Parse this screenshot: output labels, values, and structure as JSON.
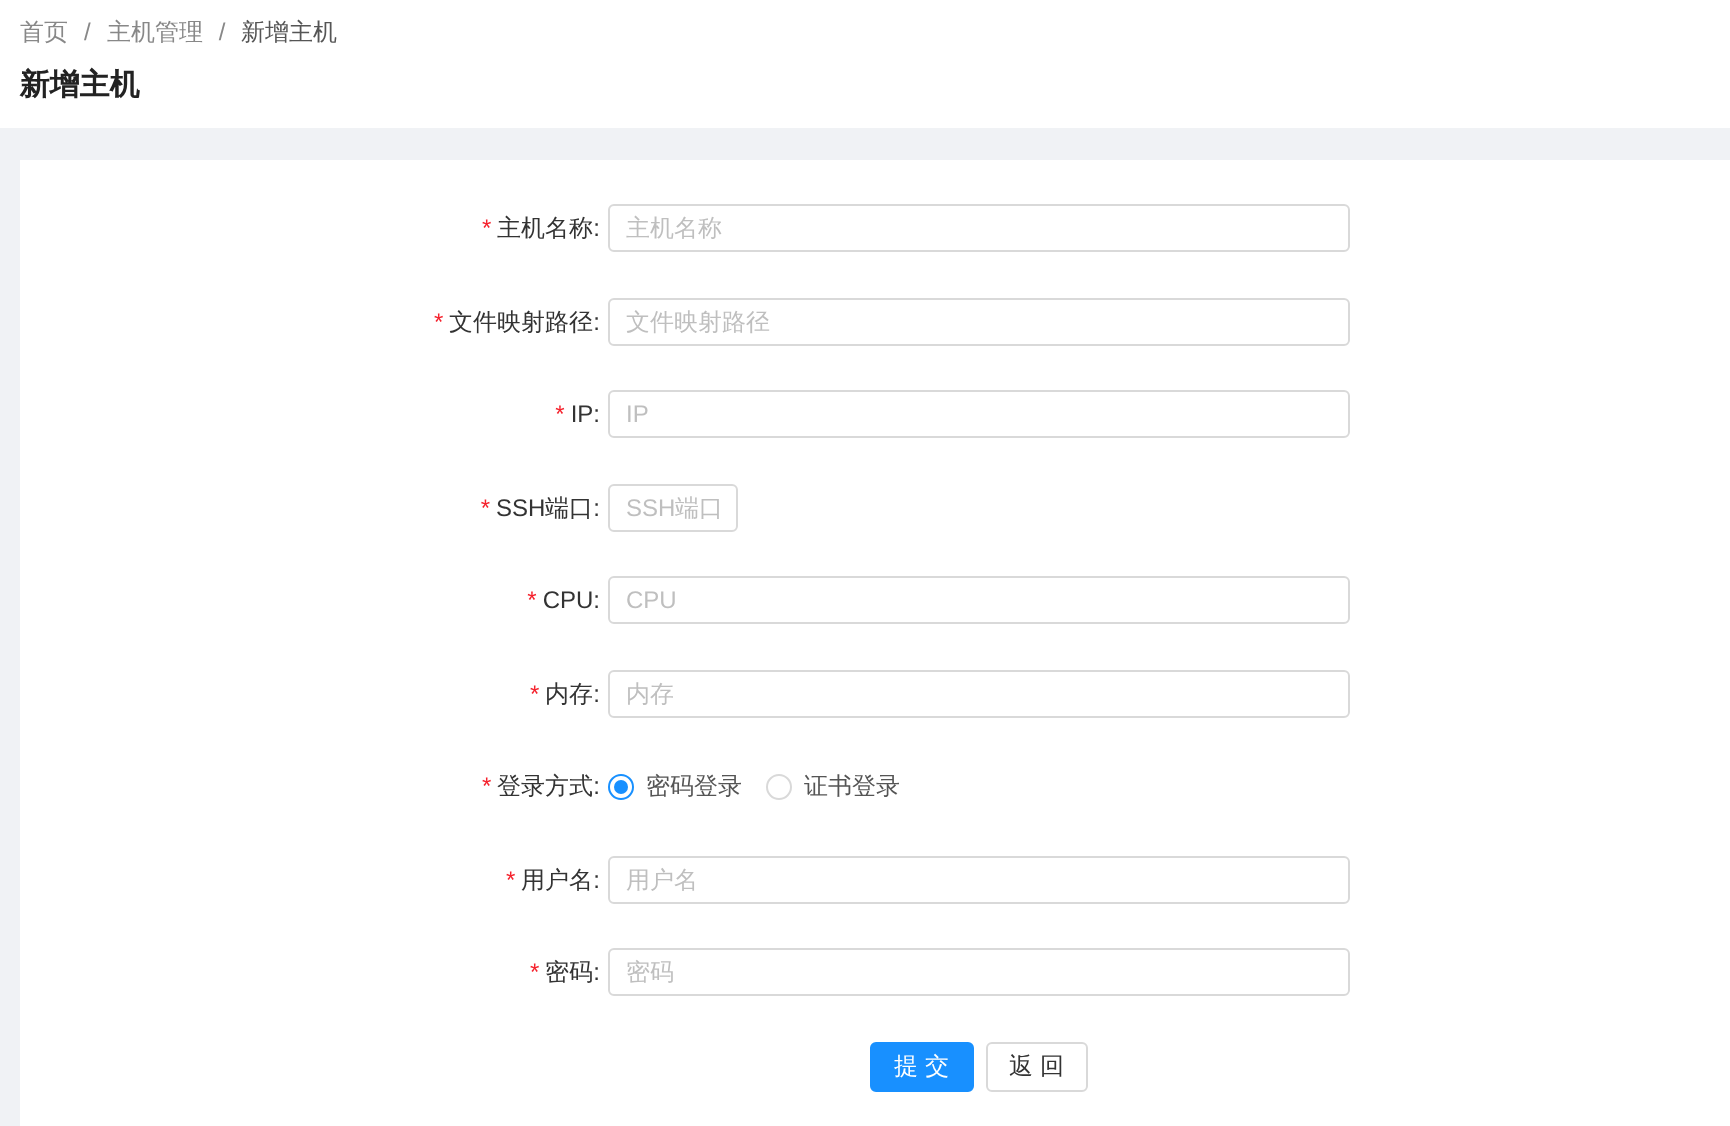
{
  "breadcrumb": [
    {
      "label": "首页",
      "current": false
    },
    {
      "label": "主机管理",
      "current": false
    },
    {
      "label": "新增主机",
      "current": true
    }
  ],
  "breadcrumb_separator": "/",
  "title": "新增主机",
  "fields": [
    {
      "kind": "input",
      "mark": "*",
      "label": "主机名称:",
      "placeholder": "主机名称",
      "short": false
    },
    {
      "kind": "input",
      "mark": "*",
      "label": "文件映射路径:",
      "placeholder": "文件映射路径",
      "short": false
    },
    {
      "kind": "input",
      "mark": "*",
      "label": "IP:",
      "placeholder": "IP",
      "short": false
    },
    {
      "kind": "input",
      "mark": "*",
      "label": "SSH端口:",
      "placeholder": "SSH端口",
      "short": true
    },
    {
      "kind": "input",
      "mark": "*",
      "label": "CPU:",
      "placeholder": "CPU",
      "short": false
    },
    {
      "kind": "input",
      "mark": "*",
      "label": "内存:",
      "placeholder": "内存",
      "short": false
    },
    {
      "kind": "radio",
      "mark": "*",
      "label": "登录方式:",
      "options": [
        {
          "label": "密码登录",
          "selected": true
        },
        {
          "label": "证书登录",
          "selected": false
        }
      ]
    },
    {
      "kind": "input",
      "mark": "*",
      "label": "用户名:",
      "placeholder": "用户名",
      "short": false
    },
    {
      "kind": "input",
      "mark": "*",
      "label": "密码:",
      "placeholder": "密码",
      "short": false
    }
  ],
  "buttons": [
    {
      "label": "提 交",
      "primary": true
    },
    {
      "label": "返 回",
      "primary": false
    }
  ]
}
